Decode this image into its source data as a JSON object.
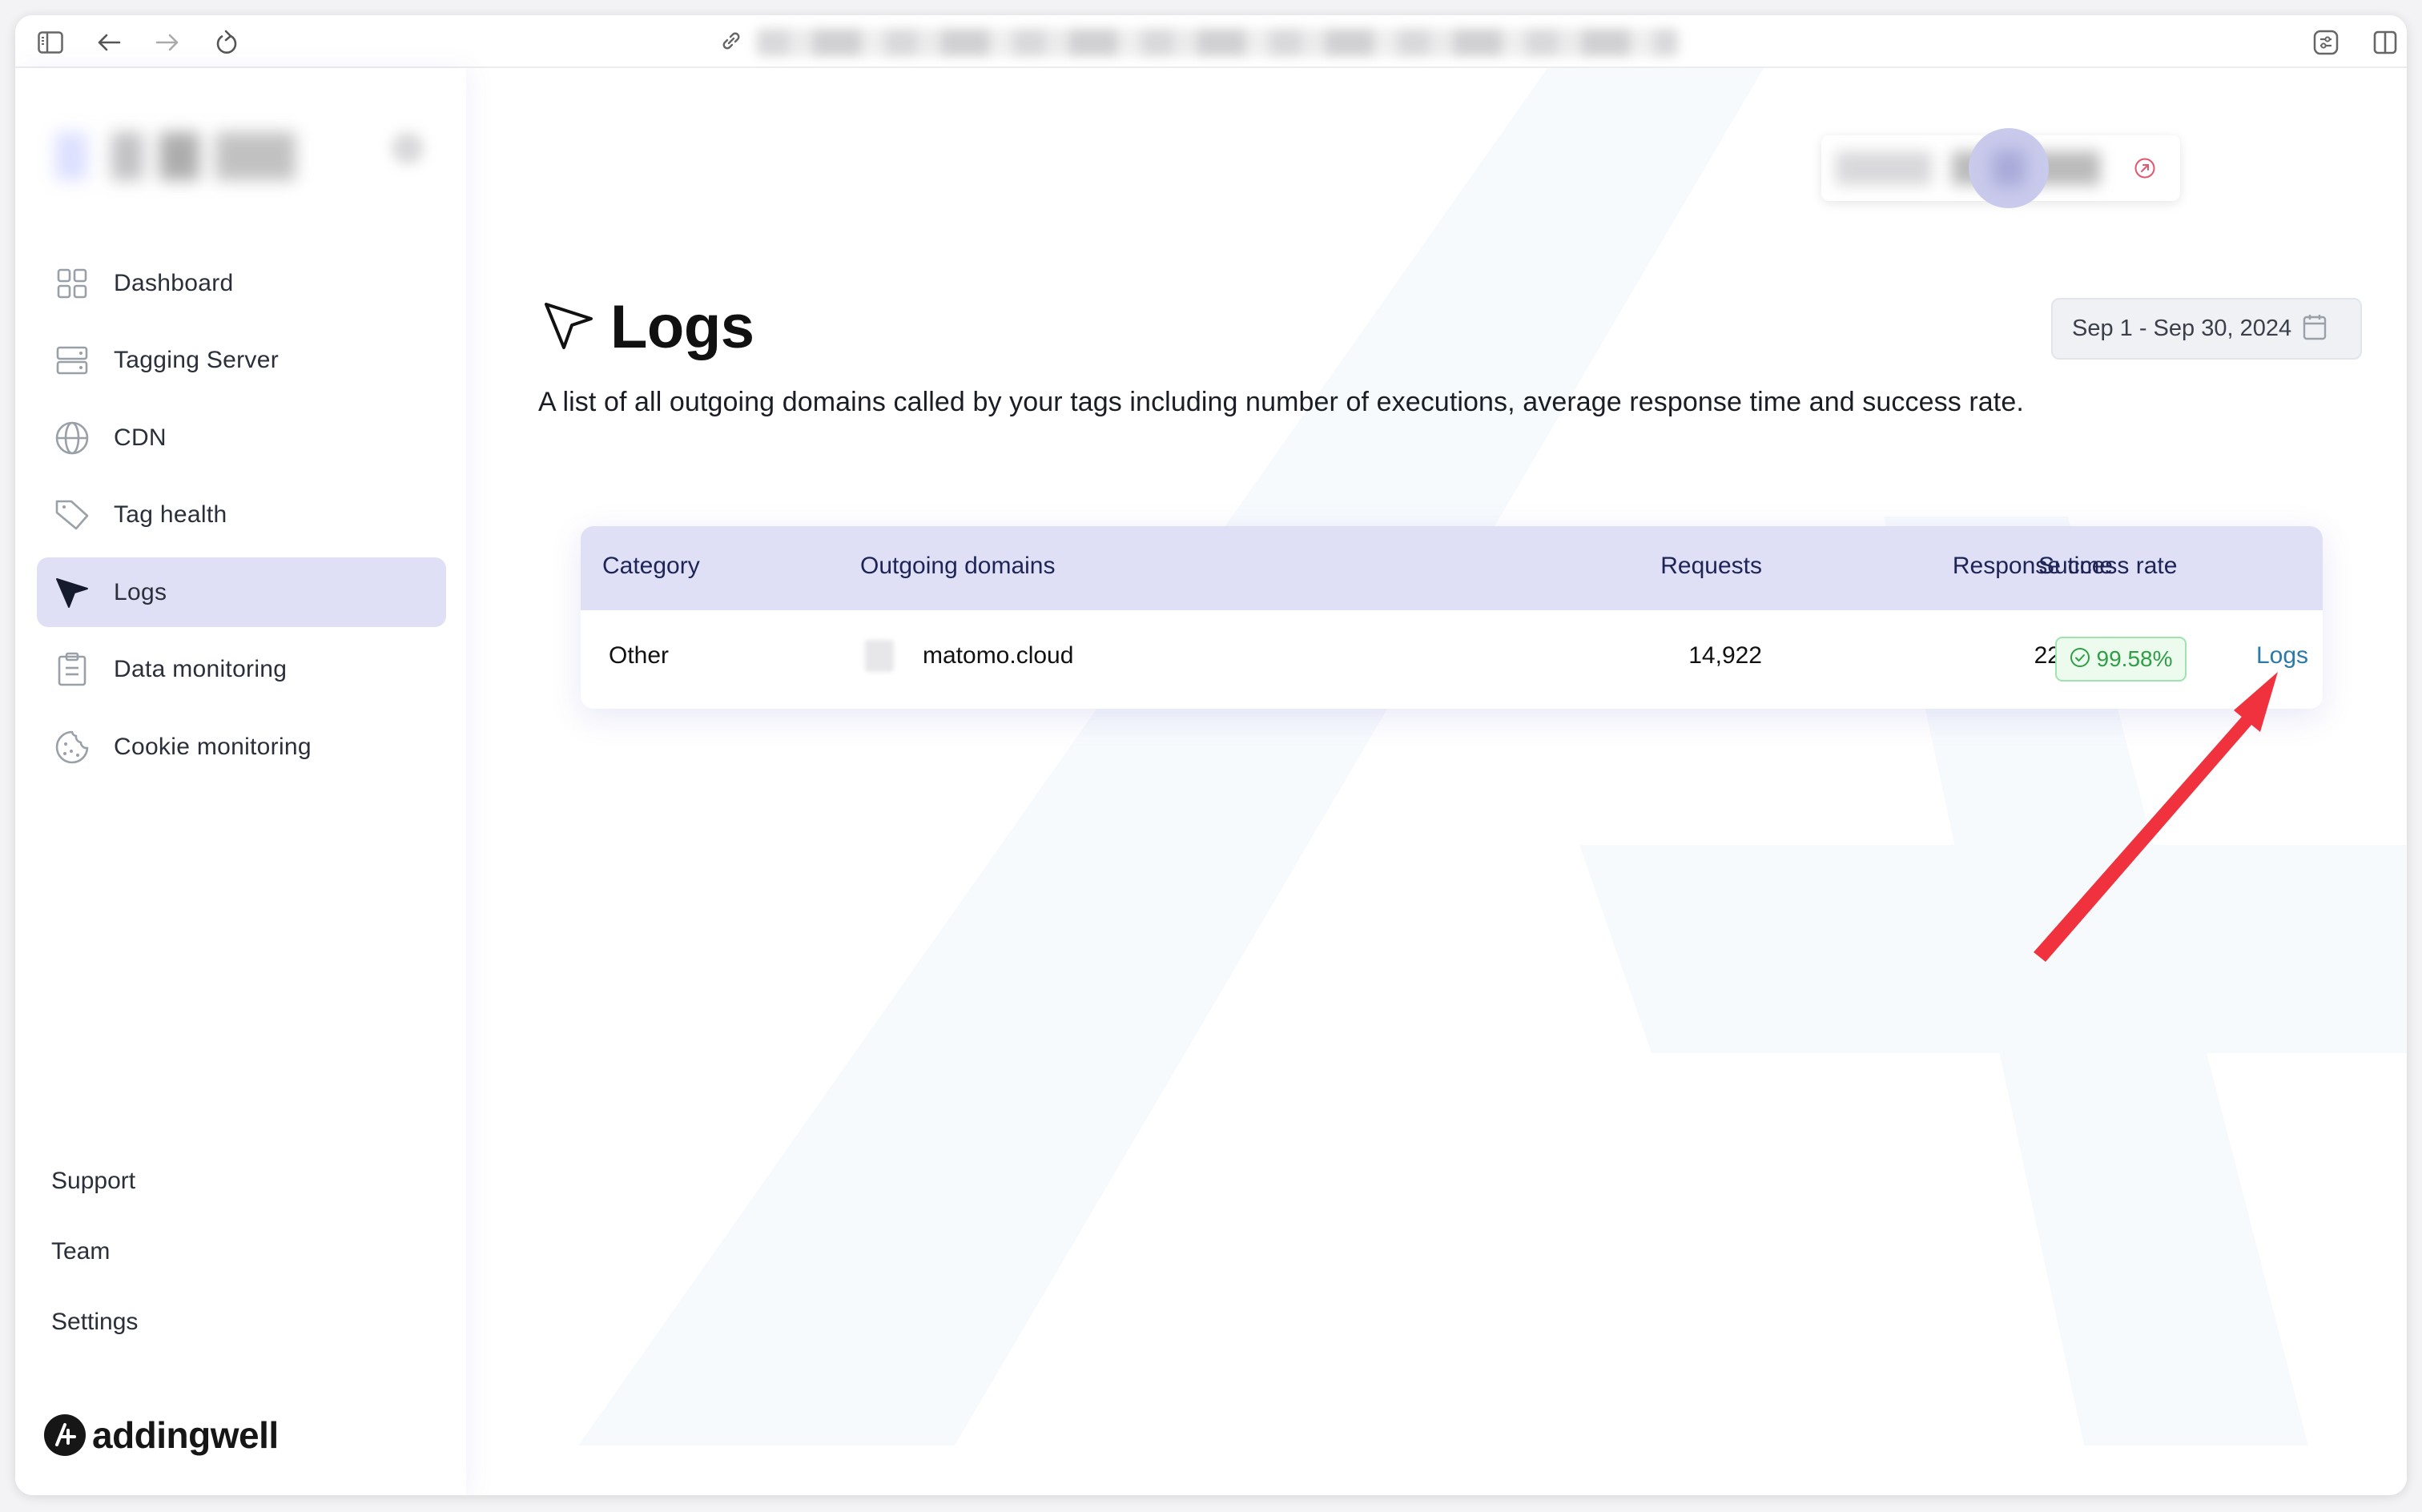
{
  "browser": {
    "url_blurred": true
  },
  "sidebar": {
    "items": [
      {
        "label": "Dashboard",
        "icon": "dashboard-grid-icon"
      },
      {
        "label": "Tagging Server",
        "icon": "server-icon"
      },
      {
        "label": "CDN",
        "icon": "globe-icon"
      },
      {
        "label": "Tag health",
        "icon": "tag-icon"
      },
      {
        "label": "Logs",
        "icon": "cursor-arrow-icon",
        "active": true
      },
      {
        "label": "Data monitoring",
        "icon": "clipboard-icon"
      },
      {
        "label": "Cookie monitoring",
        "icon": "cookie-icon"
      }
    ],
    "bottom_links": [
      "Support",
      "Team",
      "Settings"
    ],
    "logo_text": "addingwell"
  },
  "header": {
    "container_selector_blurred": true,
    "avatar_blurred": true
  },
  "page": {
    "title": "Logs",
    "description": "A list of all outgoing domains called by your tags including number of executions, average response time and success rate.",
    "date_range": "Sep 1 - Sep 30, 2024"
  },
  "table": {
    "columns": [
      "Category",
      "Outgoing domains",
      "Requests",
      "Response time",
      "Success rate"
    ],
    "rows": [
      {
        "category": "Other",
        "domain": "matomo.cloud",
        "requests": "14,922",
        "response_time": "228 ms",
        "success_rate": "99.58%",
        "action": "Logs"
      }
    ]
  },
  "colors": {
    "active_nav_bg": "#dfe0f5",
    "table_header_bg": "#dfe0f5",
    "success_green": "#2f9e44",
    "link_blue": "#2b7aa8",
    "annotation_arrow": "#f0323f"
  }
}
